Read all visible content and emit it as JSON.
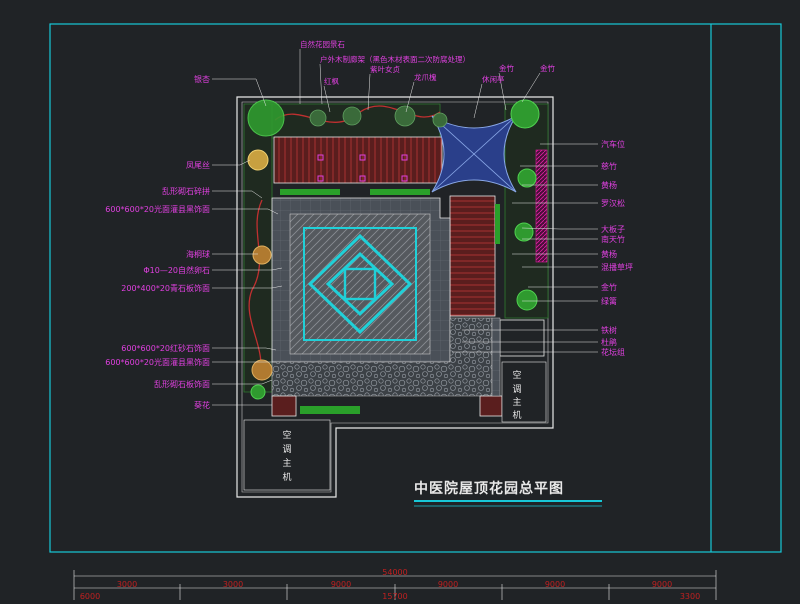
{
  "drawing": {
    "title": "中医院屋顶花园总平图",
    "left_labels": [
      "银杏",
      "凤尾丝",
      "乱形砌石碎拼",
      "600*600*20光面灌县黑饰面",
      "海桐球",
      "Φ10—20自然卵石",
      "200*400*20青石板饰面",
      "600*600*20红砂石饰面",
      "600*600*20光面灌县黑饰面",
      "乱形砌石板饰面",
      "葵花"
    ],
    "right_labels": [
      "汽车位",
      "慈竹",
      "黄杨",
      "罗汉松",
      "大板子",
      "南天竹",
      "黄杨",
      "混播草坪",
      "金竹",
      "绿篱",
      "铁树",
      "杜鹃",
      "花坛组"
    ],
    "top_labels": [
      "自然花园景石",
      "户外木制廊架（黑色木材表面二次防腐处理）",
      "红枫",
      "紫叶女贞",
      "龙爪槐",
      "休闲亭",
      "金竹",
      "金竹"
    ],
    "ac_left": [
      "空",
      "调",
      "主",
      "机"
    ],
    "ac_right": [
      "空",
      "调",
      "主",
      "机"
    ],
    "dimension_total": "54000",
    "dimensions": [
      "3000",
      "3000",
      "9000",
      "9000",
      "9000",
      "9000"
    ],
    "dimension_bottom": [
      "6000",
      "15700",
      "3300"
    ]
  },
  "colors": {
    "background": "#202326",
    "frame": "#18c8d8",
    "outline": "#e8e8e8",
    "label": "#e040e0",
    "paving": "#5a6068",
    "cyan_pattern": "#20d0d8",
    "wood": "#8a2a2a",
    "plant_green": "#30b030",
    "pavilion": "#2a4a9a",
    "dimension": "#c02020"
  }
}
